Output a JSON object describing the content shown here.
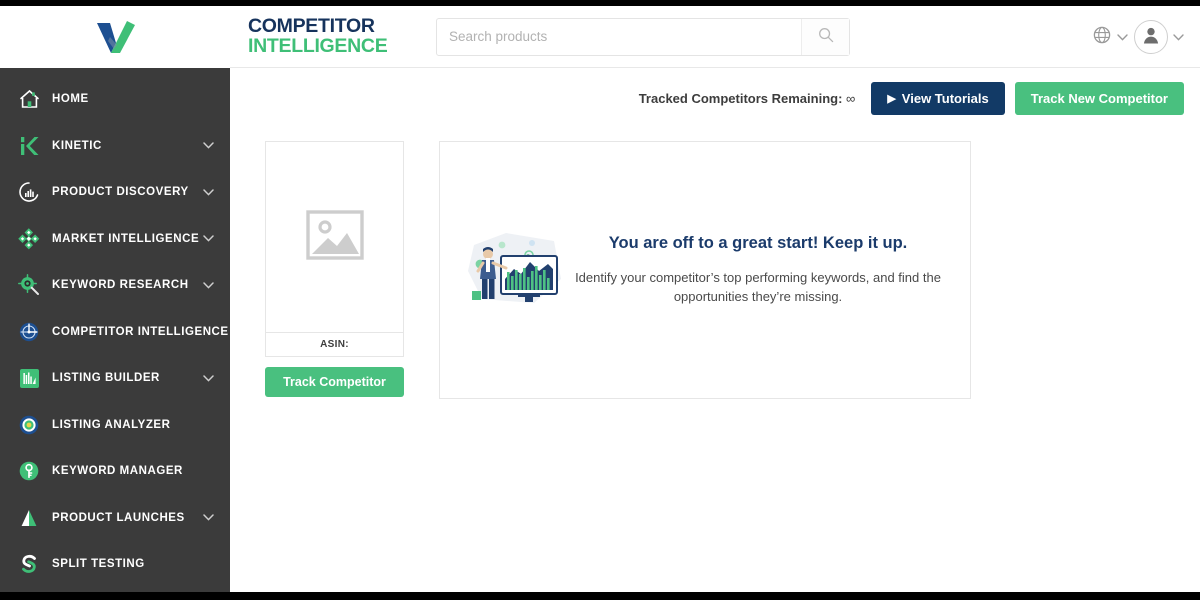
{
  "brand": {
    "logo_icon": "v-check-logo"
  },
  "sidebar": {
    "items": [
      {
        "label": "HOME",
        "icon": "home-icon",
        "chevron": false
      },
      {
        "label": "KINETIC",
        "icon": "kinetic-k-icon",
        "chevron": true
      },
      {
        "label": "PRODUCT DISCOVERY",
        "icon": "gauge-icon",
        "chevron": true
      },
      {
        "label": "MARKET INTELLIGENCE",
        "icon": "diamond-cluster-icon",
        "chevron": true
      },
      {
        "label": "KEYWORD RESEARCH",
        "icon": "target-magnifier-icon",
        "chevron": true
      },
      {
        "label": "COMPETITOR INTELLIGENCE",
        "icon": "radar-icon",
        "chevron": false
      },
      {
        "label": "LISTING BUILDER",
        "icon": "bar-chart-square-icon",
        "chevron": true
      },
      {
        "label": "LISTING ANALYZER",
        "icon": "concentric-circle-icon",
        "chevron": false
      },
      {
        "label": "KEYWORD MANAGER",
        "icon": "key-circle-icon",
        "chevron": false
      },
      {
        "label": "PRODUCT LAUNCHES",
        "icon": "rocket-triangle-icon",
        "chevron": true
      },
      {
        "label": "SPLIT TESTING",
        "icon": "split-s-icon",
        "chevron": false
      }
    ]
  },
  "header": {
    "title_line1": "COMPETITOR",
    "title_line2": "INTELLIGENCE",
    "search": {
      "placeholder": "Search products",
      "value": "",
      "icon": "search-icon"
    },
    "locale_icon": "globe-icon",
    "locale_chevron_icon": "chevron-down-icon",
    "avatar_icon": "user-avatar-icon",
    "avatar_chevron_icon": "chevron-down-icon"
  },
  "toolbar": {
    "remaining_label": "Tracked Competitors Remaining:",
    "remaining_value": "∞",
    "tutorials_label": "View Tutorials",
    "tutorials_icon": "play-icon",
    "track_new_label": "Track New Competitor"
  },
  "product_card": {
    "image_placeholder_icon": "image-placeholder-icon",
    "asin_label": "ASIN:",
    "track_label": "Track Competitor"
  },
  "info_card": {
    "illustration_icon": "analytics-presenter-illustration",
    "heading": "You are off to a great start! Keep it up.",
    "subtext": "Identify your competitor’s top performing keywords, and find the opportunities they’re missing."
  },
  "colors": {
    "sidebar_bg": "#3b3b3b",
    "accent_green": "#49c07f",
    "accent_navy": "#123a66",
    "title_navy": "#16335c",
    "title_green": "#3fbf77"
  }
}
